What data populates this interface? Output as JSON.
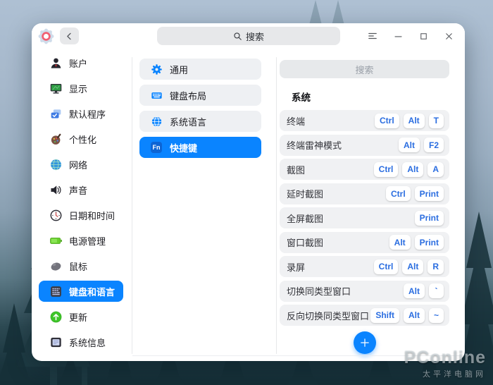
{
  "colors": {
    "accent": "#0a84ff",
    "key_text": "#2a6de0",
    "selected_text": "#ffffff"
  },
  "titlebar": {
    "search_placeholder": "搜索"
  },
  "sidebar": {
    "items": [
      {
        "icon": "account",
        "label": "账户"
      },
      {
        "icon": "display",
        "label": "显示"
      },
      {
        "icon": "default-apps",
        "label": "默认程序"
      },
      {
        "icon": "personalization",
        "label": "个性化"
      },
      {
        "icon": "network",
        "label": "网络"
      },
      {
        "icon": "sound",
        "label": "声音"
      },
      {
        "icon": "datetime",
        "label": "日期和时间"
      },
      {
        "icon": "power",
        "label": "电源管理"
      },
      {
        "icon": "mouse",
        "label": "鼠标"
      },
      {
        "icon": "keyboard-language",
        "label": "键盘和语言",
        "selected": true
      },
      {
        "icon": "update",
        "label": "更新"
      },
      {
        "icon": "system-info",
        "label": "系统信息"
      }
    ]
  },
  "nav": {
    "items": [
      {
        "icon": "general",
        "label": "通用"
      },
      {
        "icon": "keyboard-layout",
        "label": "键盘布局"
      },
      {
        "icon": "system-language",
        "label": "系统语言"
      },
      {
        "icon": "fn-shortcut",
        "label": "快捷键",
        "icon_label": "Fn",
        "selected": true
      }
    ]
  },
  "shortcuts": {
    "search_label": "搜索",
    "section_title": "系统",
    "rows": [
      {
        "label": "终端",
        "keys": [
          "Ctrl",
          "Alt",
          "T"
        ]
      },
      {
        "label": "终端雷神模式",
        "keys": [
          "Alt",
          "F2"
        ]
      },
      {
        "label": "截图",
        "keys": [
          "Ctrl",
          "Alt",
          "A"
        ]
      },
      {
        "label": "延时截图",
        "keys": [
          "Ctrl",
          "Print"
        ]
      },
      {
        "label": "全屏截图",
        "keys": [
          "Print"
        ]
      },
      {
        "label": "窗口截图",
        "keys": [
          "Alt",
          "Print"
        ]
      },
      {
        "label": "录屏",
        "keys": [
          "Ctrl",
          "Alt",
          "R"
        ]
      },
      {
        "label": "切换同类型窗口",
        "keys": [
          "Alt",
          "`"
        ]
      },
      {
        "label": "反向切换同类型窗口",
        "keys": [
          "Shift",
          "Alt",
          "~"
        ]
      }
    ]
  },
  "watermark": {
    "brand": "PConline",
    "subtitle": "太平洋电脑网"
  }
}
